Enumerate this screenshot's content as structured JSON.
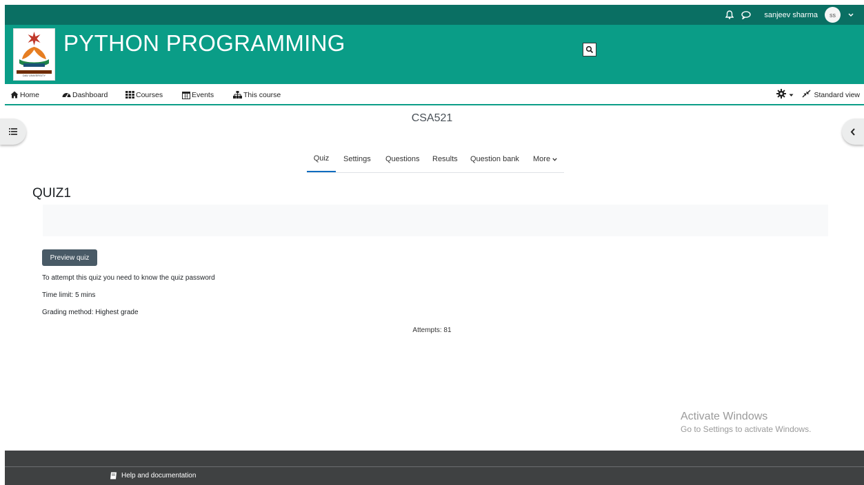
{
  "topbar": {
    "username": "sanjeev sharma",
    "avatar_initials": "ss",
    "icons": [
      "bell-icon",
      "chat-icon",
      "chevron-down-icon"
    ]
  },
  "header": {
    "site_title": "PYTHON PROGRAMMING",
    "logo_text": "DAV UNIVERSITY",
    "brand_color": "#0a9d87",
    "topbar_color": "#0a6f63"
  },
  "nav": {
    "items": [
      {
        "label": "Home",
        "icon": "home-icon"
      },
      {
        "label": "Dashboard",
        "icon": "dashboard-icon"
      },
      {
        "label": "Courses",
        "icon": "grid-icon"
      },
      {
        "label": "Events",
        "icon": "calendar-icon"
      },
      {
        "label": "This course",
        "icon": "sitemap-icon"
      }
    ],
    "standard_view": "Standard view"
  },
  "course": {
    "code": "CSA521"
  },
  "tabs": {
    "items": [
      "Quiz",
      "Settings",
      "Questions",
      "Results",
      "Question bank",
      "More"
    ],
    "active": "Quiz"
  },
  "quiz": {
    "title": "QUIZ1",
    "preview_button": "Preview quiz",
    "password_note": "To attempt this quiz you need to know the quiz password",
    "time_limit": "Time limit: 5 mins",
    "grading": "Grading method: Highest grade",
    "attempts": "Attempts: 81"
  },
  "watermark": {
    "line1": "Activate Windows",
    "line2": "Go to Settings to activate Windows."
  },
  "footer": {
    "help": "Help and documentation"
  }
}
